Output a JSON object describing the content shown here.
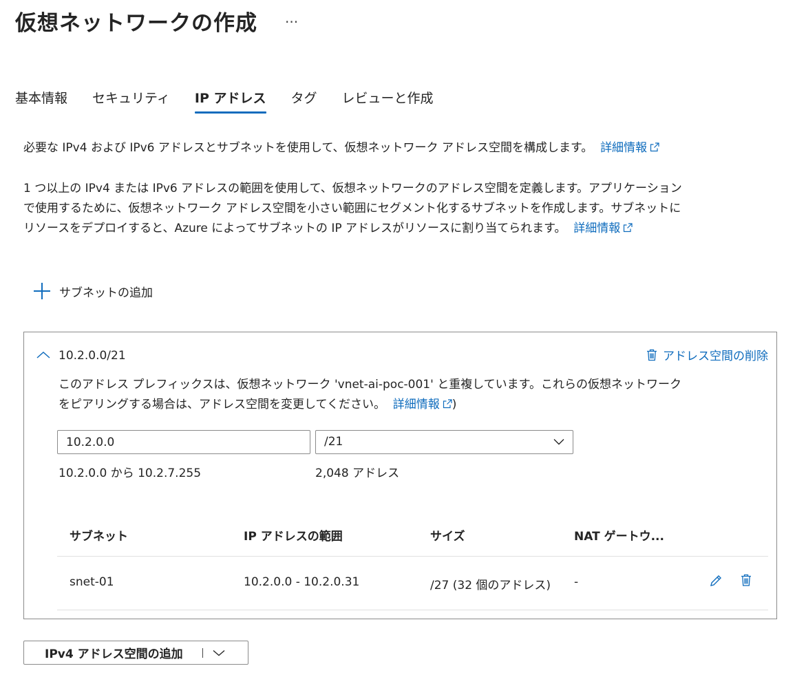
{
  "header": {
    "title": "仮想ネットワークの作成",
    "more": "···"
  },
  "tabs": [
    {
      "label": "基本情報",
      "active": false
    },
    {
      "label": "セキュリティ",
      "active": false
    },
    {
      "label": "IP アドレス",
      "active": true
    },
    {
      "label": "タグ",
      "active": false
    },
    {
      "label": "レビューと作成",
      "active": false
    }
  ],
  "intro": {
    "text": "必要な IPv4 および IPv6 アドレスとサブネットを使用して、仮想ネットワーク アドレス空間を構成します。",
    "link": "詳細情報"
  },
  "description": {
    "line1": "1 つ以上の IPv4 または IPv6 アドレスの範囲を使用して、仮想ネットワークのアドレス空間を定義します。アプリケーション",
    "line2": "で使用するために、仮想ネットワーク アドレス空間を小さい範囲にセグメント化するサブネットを作成します。サブネットに",
    "line3": "リソースをデプロイすると、Azure によってサブネットの IP アドレスがリソースに割り当てられます。",
    "link": "詳細情報"
  },
  "add_subnet": {
    "label": "サブネットの追加"
  },
  "address_space": {
    "cidr": "10.2.0.0/21",
    "delete_label": "アドレス空間の削除",
    "warning_line1": "このアドレス プレフィックスは、仮想ネットワーク 'vnet-ai-poc-001' と重複しています。これらの仮想ネットワーク",
    "warning_line2": "をピアリングする場合は、アドレス空間を変更してください。",
    "warning_link": "詳細情報",
    "warning_close": ")",
    "address_value": "10.2.0.0",
    "prefix_value": "/21",
    "range_text": "10.2.0.0 から 10.2.7.255",
    "count_text": "2,048 アドレス"
  },
  "subnet_table": {
    "columns": [
      "サブネット",
      "IP アドレスの範囲",
      "サイズ",
      "NAT ゲートウ..."
    ],
    "rows": [
      {
        "name": "snet-01",
        "range": "10.2.0.0 - 10.2.0.31",
        "size": "/27 (32 個のアドレス)",
        "nat": "-"
      }
    ]
  },
  "add_ipv4": {
    "label": "IPv4 アドレス空間の追加"
  },
  "colors": {
    "accent": "#0f6cbd",
    "text": "#242424",
    "border": "#8a8a8a"
  },
  "icons": [
    "more-icon",
    "external-link-icon",
    "plus-icon",
    "chevron-up-icon",
    "trash-icon",
    "chevron-down-icon",
    "pencil-icon"
  ]
}
